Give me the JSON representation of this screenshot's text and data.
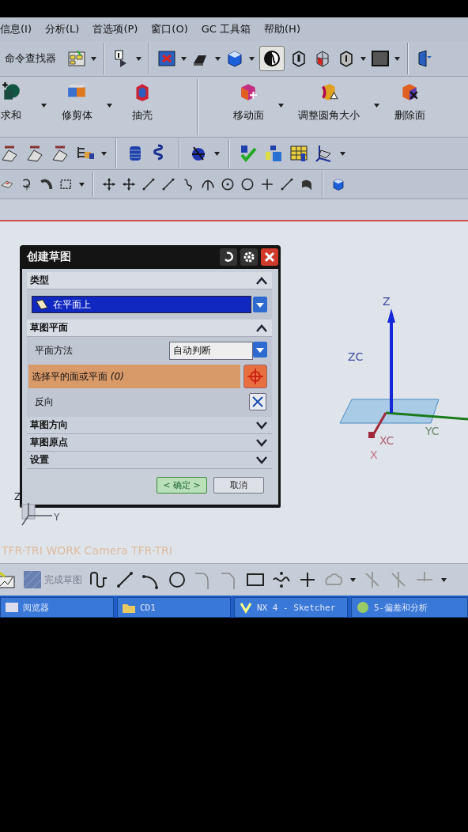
{
  "menu": [
    {
      "label": "信息(I)"
    },
    {
      "label": "分析(L)"
    },
    {
      "label": "首选项(P)"
    },
    {
      "label": "窗口(O)"
    },
    {
      "label": "GC 工具箱"
    },
    {
      "label": "帮助(H)"
    }
  ],
  "command_finder": {
    "label": "命令查找器"
  },
  "feature_tools": [
    {
      "label": "求和"
    },
    {
      "label": "修剪体"
    },
    {
      "label": "抽壳"
    },
    {
      "label": "移动面"
    },
    {
      "label": "调整圆角大小"
    },
    {
      "label": "删除面"
    }
  ],
  "dialog": {
    "title": "创建草图",
    "sections": [
      {
        "title": "类型",
        "expanded": true,
        "kind": "type",
        "value": "在平面上"
      },
      {
        "title": "草图平面",
        "expanded": true,
        "kind": "plane",
        "method_label": "平面方法",
        "method_value": "自动判断",
        "selection_label": "选择平的面或平面 *(0)*",
        "reverse_label": "反向"
      },
      {
        "title": "草图方向",
        "expanded": false
      },
      {
        "title": "草图原点",
        "expanded": false
      },
      {
        "title": "设置",
        "expanded": false
      }
    ],
    "buttons": [
      {
        "label": "< 确定 >",
        "kind": "default"
      },
      {
        "label": "取消",
        "kind": "normal"
      }
    ]
  },
  "viewport": {
    "axis_labels": [
      "Z",
      "ZC",
      "YC",
      "XC",
      "X"
    ],
    "triad_labels": [
      "Z",
      "Y"
    ],
    "status_text": "TFR-TRI WORK Camera TFR-TRI"
  },
  "sketch_toolbar": {
    "finish_label": "完成草图"
  },
  "taskbar": [
    {
      "label": "阅览器"
    },
    {
      "label": "CD1"
    },
    {
      "label": "NX 4 - Sketcher"
    },
    {
      "label": "5-偏差和分析"
    }
  ]
}
